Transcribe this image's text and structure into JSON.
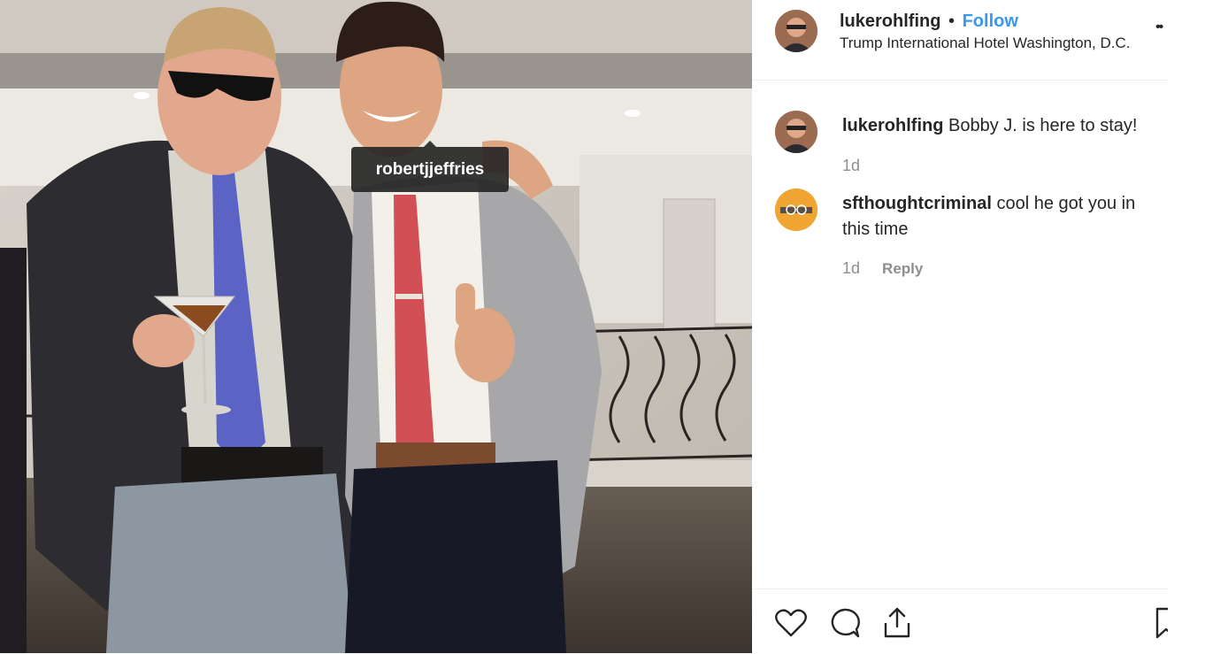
{
  "post": {
    "tag_username": "robertjjeffries"
  },
  "header": {
    "username": "lukerohlfing",
    "separator": "•",
    "follow_label": "Follow",
    "location": "Trump International Hotel Washington, D.C.",
    "more_icon": "ellipsis-icon"
  },
  "comments": [
    {
      "username": "lukerohlfing",
      "text": "Bobby J. is here to stay!",
      "time": "1d",
      "reply_label": ""
    },
    {
      "username": "sfthoughtcriminal",
      "text": "cool he got you in this time",
      "time": "1d",
      "reply_label": "Reply"
    }
  ],
  "actions": {
    "like_icon": "heart-icon",
    "comment_icon": "comment-icon",
    "share_icon": "share-icon",
    "save_icon": "bookmark-icon"
  },
  "colors": {
    "accent": "#3897f0",
    "muted": "#8e8e8e",
    "text": "#262626"
  }
}
